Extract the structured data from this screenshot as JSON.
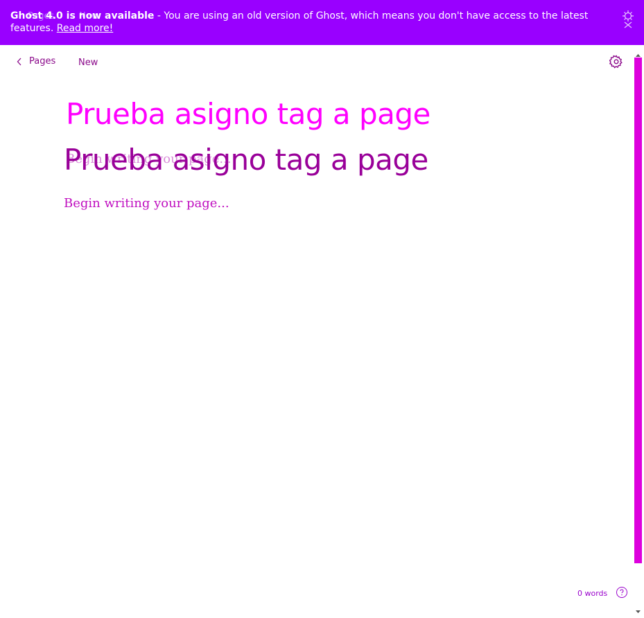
{
  "banner": {
    "ghost_breadcrumb": "Pages",
    "ghost_status": "New",
    "headline": "Ghost 4.0 is now available",
    "message": " - You are using an old version of Ghost, which means you don't have access to the latest features. ",
    "link": "Read more!"
  },
  "toolbar": {
    "back_label": "Pages",
    "status": "New"
  },
  "editor": {
    "title_ghost": "Prueba asigno tag a page",
    "title": "Prueba asigno tag a page",
    "placeholder_ghost": "Begin writing your page...",
    "placeholder": "Begin writing your page..."
  },
  "footer": {
    "word_count": "0 words"
  },
  "icons": [
    "chevron-left-icon",
    "gear-icon",
    "close-icon",
    "help-icon"
  ],
  "colors": {
    "banner": "#9900ff",
    "accent": "#990099",
    "title_ghost": "#ff00ff",
    "scrollbar_thumb": "#dd00dd"
  }
}
